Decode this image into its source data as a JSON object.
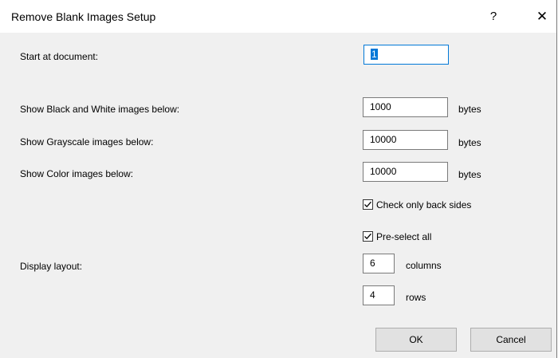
{
  "dialog": {
    "title": "Remove Blank Images Setup",
    "help_label": "?",
    "close_label": "✕"
  },
  "fields": {
    "start_label": "Start at document:",
    "start_value": "1",
    "bw_label": "Show Black and White images below:",
    "bw_value": "1000",
    "gray_label": "Show Grayscale images below:",
    "gray_value": "10000",
    "color_label": "Show Color images below:",
    "color_value": "10000",
    "bytes_unit": "bytes"
  },
  "options": {
    "back_sides_label": "Check only back sides",
    "back_sides_checked": true,
    "preselect_label": "Pre-select all",
    "preselect_checked": true
  },
  "layout": {
    "label": "Display layout:",
    "columns_value": "6",
    "columns_unit": "columns",
    "rows_value": "4",
    "rows_unit": "rows"
  },
  "buttons": {
    "ok_label": "OK",
    "cancel_label": "Cancel"
  }
}
